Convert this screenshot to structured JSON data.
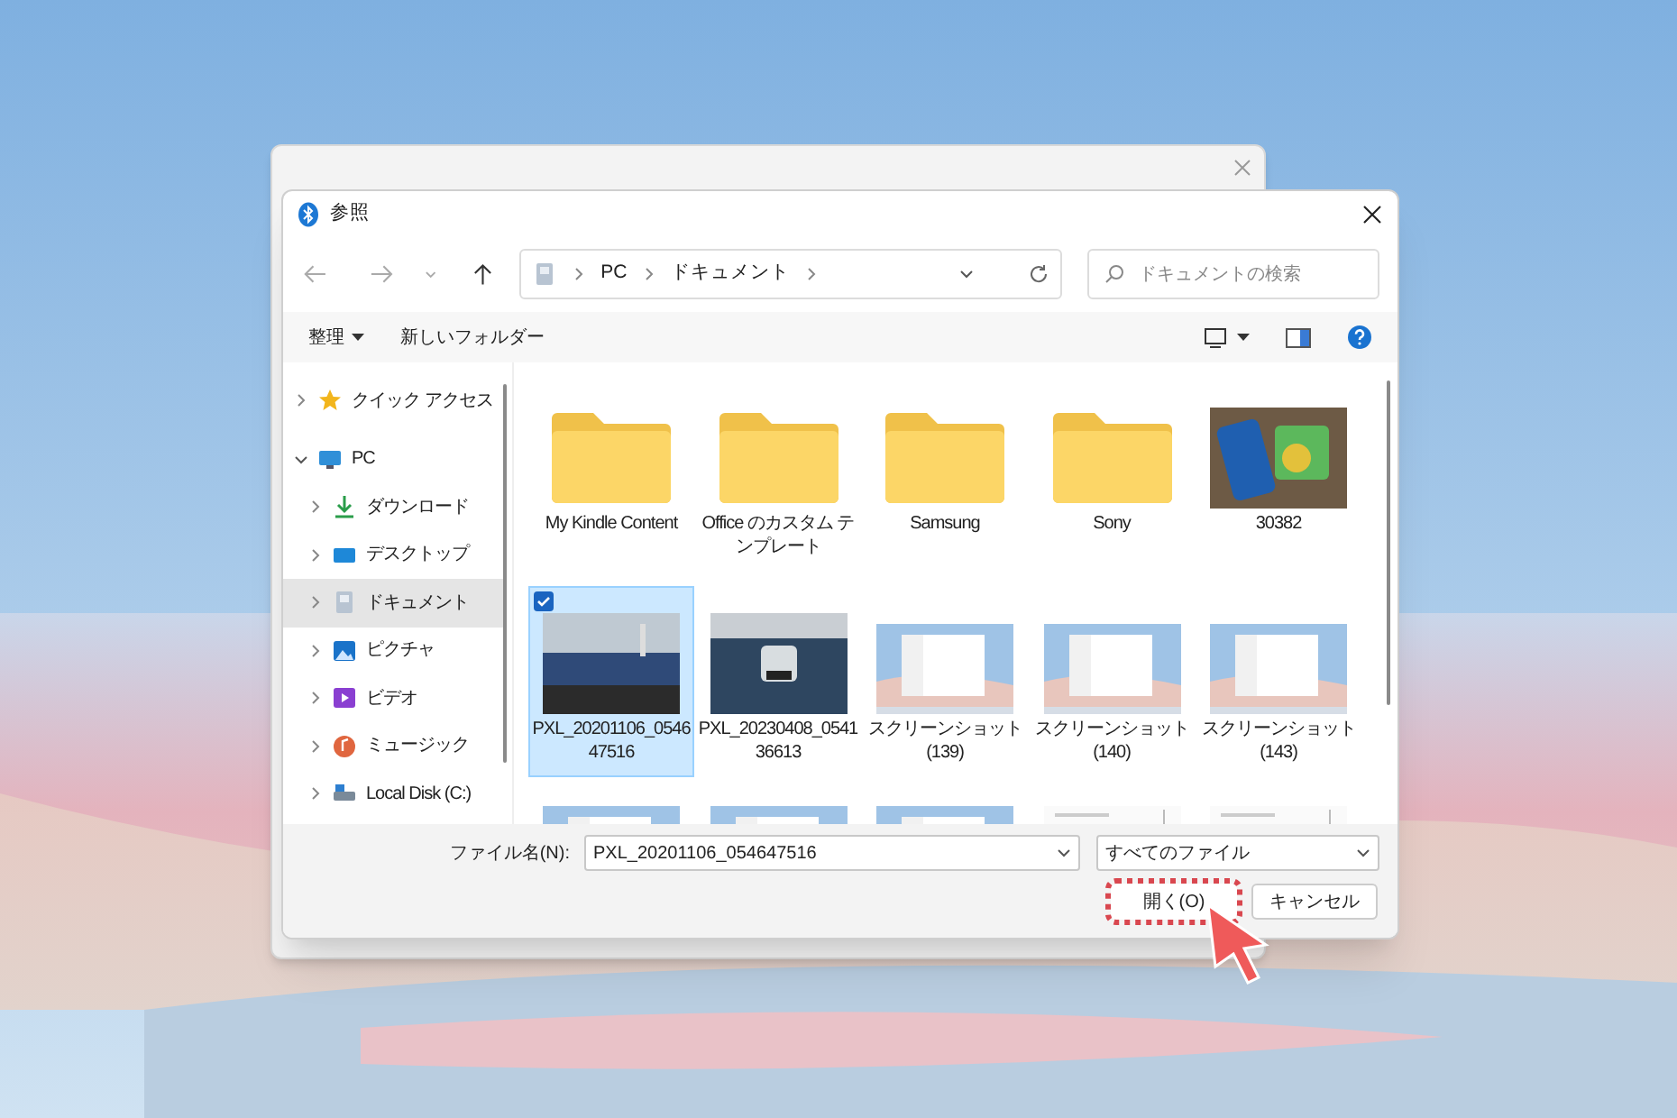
{
  "dialog": {
    "title": "参照",
    "address": {
      "segments": [
        "PC",
        "ドキュメント"
      ]
    },
    "search": {
      "placeholder": "ドキュメントの検索"
    },
    "toolbar": {
      "organize": "整理",
      "new_folder": "新しいフォルダー"
    },
    "sidebar": {
      "items": [
        {
          "label": "クイック アクセス",
          "kind": "star",
          "expanded": false,
          "selected": false
        },
        {
          "label": "PC",
          "kind": "monitor",
          "expanded": true,
          "selected": false,
          "children": [
            {
              "label": "ダウンロード",
              "kind": "download",
              "expanded": false,
              "selected": false
            },
            {
              "label": "デスクトップ",
              "kind": "desktop",
              "expanded": false,
              "selected": false
            },
            {
              "label": "ドキュメント",
              "kind": "document",
              "expanded": false,
              "selected": true
            },
            {
              "label": "ピクチャ",
              "kind": "pictures",
              "expanded": false,
              "selected": false
            },
            {
              "label": "ビデオ",
              "kind": "video",
              "expanded": false,
              "selected": false
            },
            {
              "label": "ミュージック",
              "kind": "music",
              "expanded": false,
              "selected": false
            },
            {
              "label": "Local Disk (C:)",
              "kind": "disk",
              "expanded": false,
              "selected": false
            }
          ]
        }
      ]
    },
    "files": [
      {
        "name": "My Kindle Content",
        "kind": "folder",
        "selected": false
      },
      {
        "name": "Office のカスタム テンプレート",
        "kind": "folder",
        "selected": false
      },
      {
        "name": "Samsung",
        "kind": "folder",
        "selected": false
      },
      {
        "name": "Sony",
        "kind": "folder",
        "selected": false
      },
      {
        "name": "30382",
        "selected": false
      },
      {
        "name": "PXL_20201106_054647516",
        "selected": true
      },
      {
        "name": "PXL_20230408_054136613",
        "selected": false
      },
      {
        "name": "スクリーンショット (139)",
        "kind": "screenshot",
        "selected": false
      },
      {
        "name": "スクリーンショット (140)",
        "kind": "screenshot",
        "selected": false
      },
      {
        "name": "スクリーンショット (143)",
        "kind": "screenshot",
        "selected": false
      }
    ],
    "partial_row": [
      {
        "kind": "screenshot"
      },
      {
        "kind": "screenshot"
      },
      {
        "kind": "screenshot"
      },
      {
        "kind": "document"
      },
      {
        "kind": "document"
      }
    ],
    "file_name": {
      "label": "ファイル名(N):",
      "value": "PXL_20201106_054647516"
    },
    "file_type": {
      "value": "すべてのファイル"
    },
    "buttons": [
      {
        "label": "開く(O)",
        "highlighted": true
      },
      {
        "label": "キャンセル",
        "highlighted": false
      }
    ]
  }
}
